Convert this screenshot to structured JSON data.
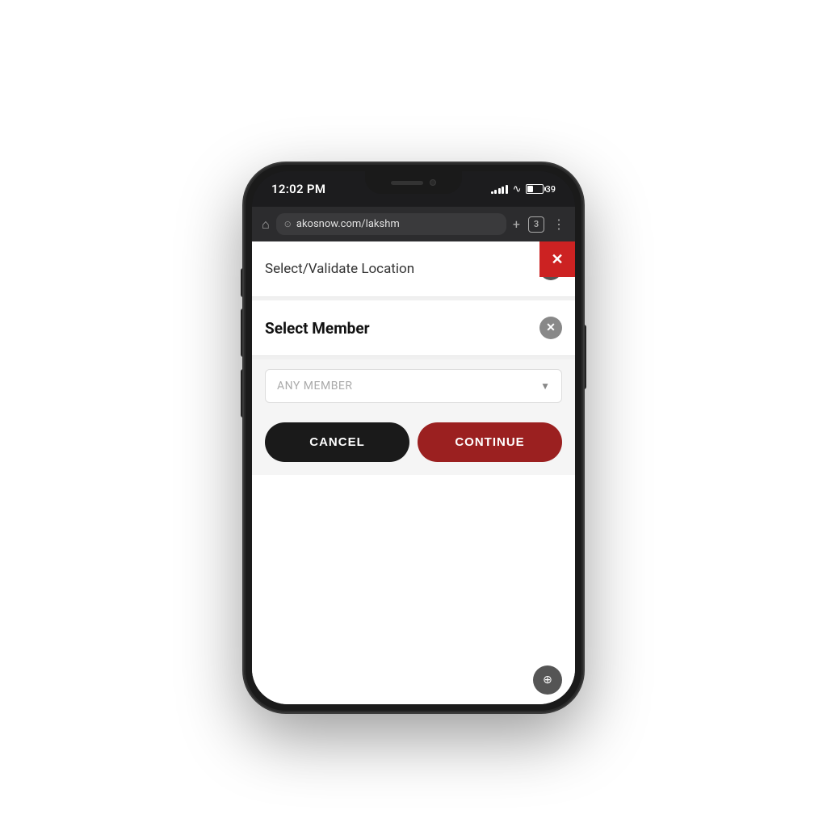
{
  "phone": {
    "status_bar": {
      "time": "12:02 PM",
      "battery_level": "39",
      "signal_bars": [
        3,
        5,
        7,
        9,
        11
      ],
      "wifi_symbol": "WiFi"
    },
    "browser": {
      "url": "akosnow.com/lakshm",
      "tabs_count": "3",
      "home_icon": "⌂",
      "add_tab_icon": "+",
      "menu_icon": "⋮"
    },
    "content": {
      "close_button": "✕",
      "section1": {
        "title": "Select/Validate Location",
        "icon": "+"
      },
      "section2": {
        "title": "Select Member",
        "icon": "✕"
      },
      "dropdown": {
        "placeholder": "ANY MEMBER",
        "arrow": "▼"
      },
      "buttons": {
        "cancel_label": "CANCEL",
        "continue_label": "CONTINUE"
      }
    }
  }
}
